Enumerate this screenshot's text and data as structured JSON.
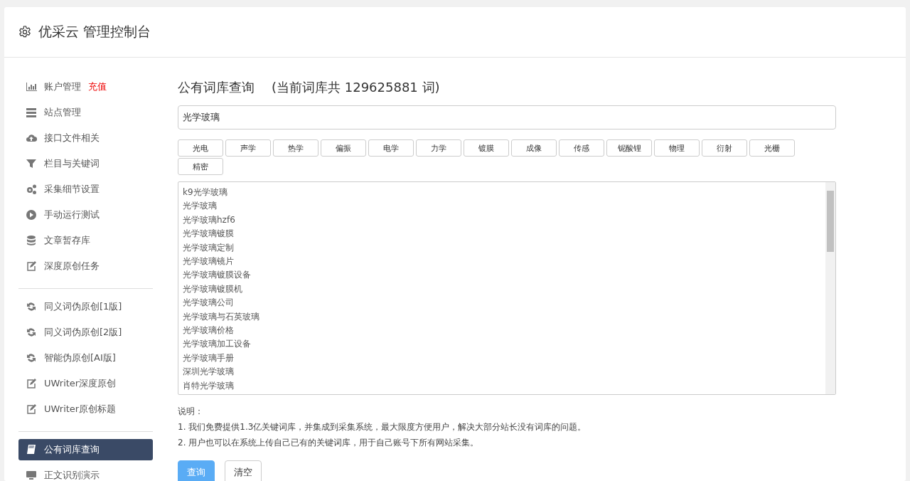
{
  "header": {
    "title": "优采云 管理控制台"
  },
  "sidebar": {
    "groups": [
      [
        {
          "label": "账户管理",
          "badge": "充值",
          "selected": false
        },
        {
          "label": "站点管理",
          "selected": false
        },
        {
          "label": "接口文件相关",
          "selected": false
        },
        {
          "label": "栏目与关键词",
          "selected": false
        },
        {
          "label": "采集细节设置",
          "selected": false
        },
        {
          "label": "手动运行测试",
          "selected": false
        },
        {
          "label": "文章暂存库",
          "selected": false
        },
        {
          "label": "深度原创任务",
          "selected": false
        }
      ],
      [
        {
          "label": "同义词伪原创[1版]",
          "selected": false
        },
        {
          "label": "同义词伪原创[2版]",
          "selected": false
        },
        {
          "label": "智能伪原创[AI版]",
          "selected": false
        },
        {
          "label": "UWriter深度原创",
          "selected": false
        },
        {
          "label": "UWriter原创标题",
          "selected": false
        }
      ],
      [
        {
          "label": "公有词库查询",
          "selected": true
        },
        {
          "label": "正文识别演示",
          "selected": false
        }
      ]
    ]
  },
  "main": {
    "title": "公有词库查询",
    "count_note": "(当前词库共 129625881 词)",
    "search": {
      "value": "光学玻璃"
    },
    "tags": [
      "光电",
      "声学",
      "热学",
      "偏振",
      "电学",
      "力学",
      "镀膜",
      "成像",
      "传感",
      "铌酸锂",
      "物理",
      "衍射",
      "光栅",
      "精密"
    ],
    "results": [
      "k9光学玻璃",
      "光学玻璃",
      "光学玻璃hzf6",
      "光学玻璃镀膜",
      "光学玻璃定制",
      "光学玻璃镜片",
      "光学玻璃镀膜设备",
      "光学玻璃镀膜机",
      "光学玻璃公司",
      "光学玻璃与石英玻璃",
      "光学玻璃价格",
      "光学玻璃加工设备",
      "光学玻璃手册",
      "深圳光学玻璃",
      "肖特光学玻璃"
    ],
    "notes_title": "说明：",
    "notes": [
      "1. 我们免费提供1.3亿关键词库，并集成到采集系统，最大限度方便用户，解决大部分站长没有词库的问题。",
      "2. 用户也可以在系统上传自己已有的关键词库，用于自己账号下所有网站采集。"
    ],
    "buttons": [
      {
        "label": "查询",
        "kind": "primary"
      },
      {
        "label": "清空",
        "kind": "default"
      }
    ]
  }
}
